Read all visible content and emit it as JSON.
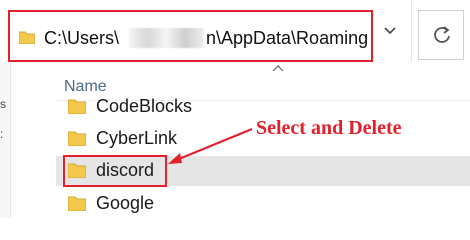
{
  "address_bar": {
    "path_prefix": "C:\\Users\\",
    "path_suffix": "n\\AppData\\Roaming",
    "dropdown_icon": "chevron-down-icon",
    "refresh_icon": "refresh-icon"
  },
  "file_list": {
    "column_header": "Name",
    "items": [
      {
        "label": "CodeBlocks",
        "icon": "folder-icon"
      },
      {
        "label": "CyberLink",
        "icon": "folder-icon"
      },
      {
        "label": "discord",
        "icon": "folder-icon",
        "selected": true
      },
      {
        "label": "Google",
        "icon": "folder-icon"
      }
    ]
  },
  "annotation": {
    "text": "Select and Delete",
    "color": "#e3202b"
  },
  "colors": {
    "highlight": "#e3202b",
    "selected_row": "#e5e5e5",
    "folder": "#f2c94c"
  }
}
